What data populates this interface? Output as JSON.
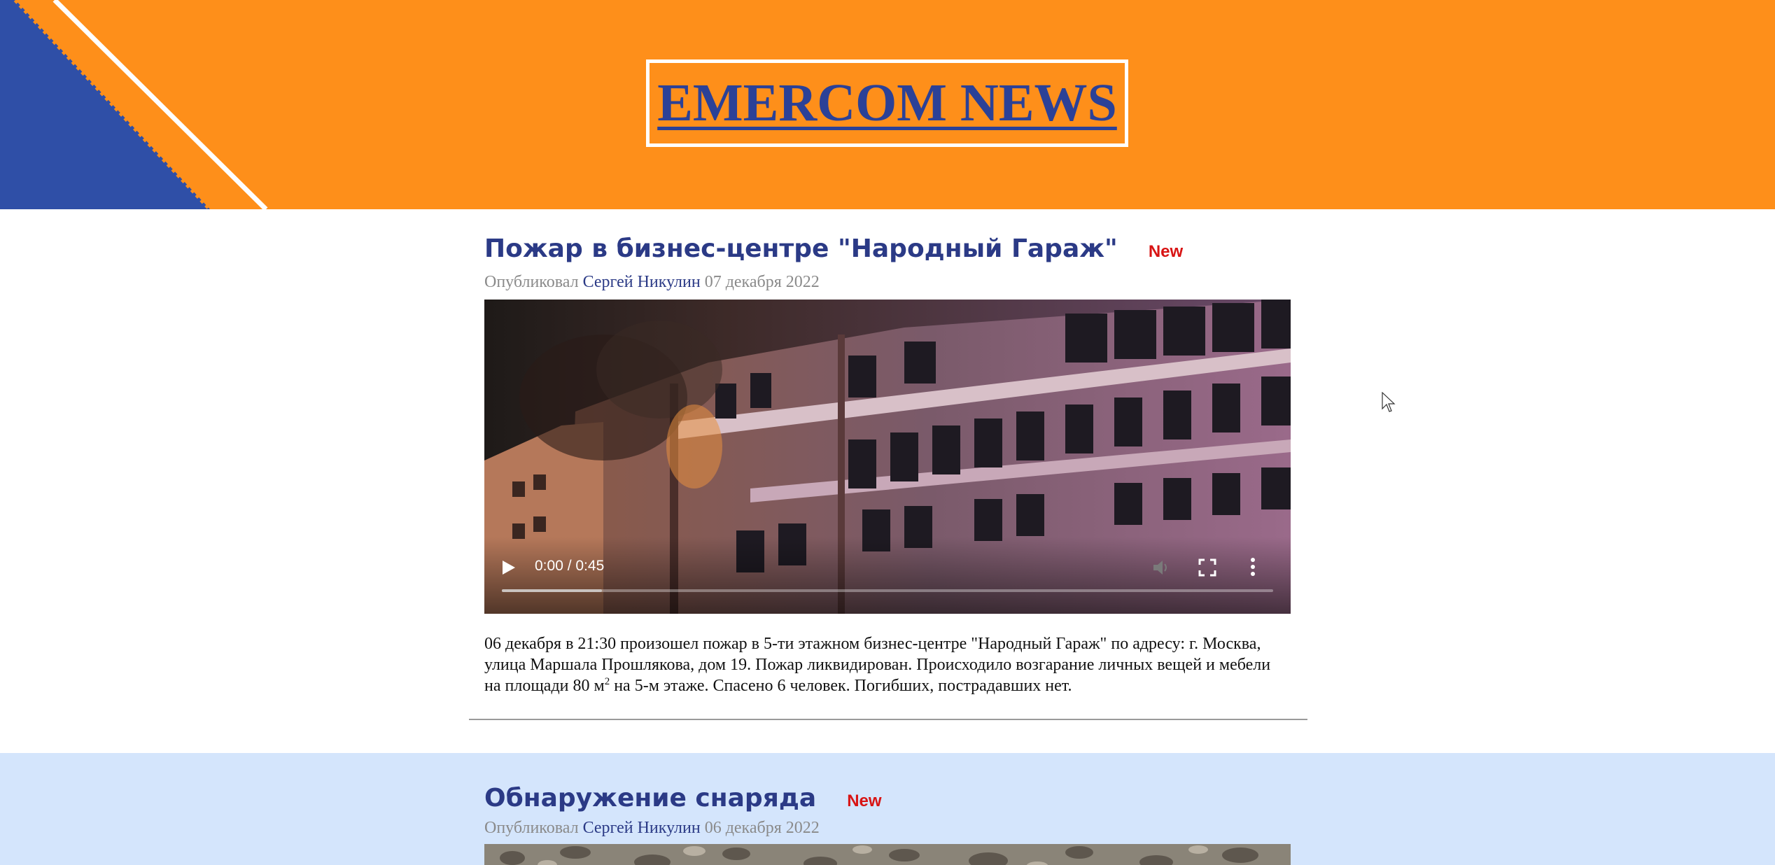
{
  "header": {
    "logo_text": "EMERCOM NEWS",
    "colors": {
      "background": "#fe8f1a",
      "accent_blue": "#2f4fa7",
      "logo_text": "#2b4197"
    }
  },
  "articles": [
    {
      "title": "Пожар в бизнес-центре \"Народный Гараж\"",
      "badge": "New",
      "meta_prefix": "Опубликовал",
      "author": "Сергей Никулин",
      "date": "07 декабря 2022",
      "video": {
        "time": "0:00 / 0:45",
        "buffered_fraction": 0.13,
        "controls": [
          "play-icon",
          "mute-icon",
          "fullscreen-icon",
          "more-options-icon"
        ]
      },
      "body_part1": "06 декабря в 21:30 произошел пожар в 5-ти этажном бизнес-центре \"Народный Гараж\" по адресу: г. Москва, улица Маршала Прошлякова, дом 19. Пожар ликвидирован. Происходило возгарание личных вещей и мебели на площади 80 м",
      "body_sup": "2",
      "body_part2": " на 5-м этаже. Спасено 6 человек. Погибших, пострадавших нет."
    },
    {
      "title": "Обнаружение снаряда",
      "badge": "New",
      "meta_prefix": "Опубликовал",
      "author": "Сергей Никулин",
      "date": "06 декабря 2022"
    }
  ],
  "colors": {
    "article_alt_bg": "#d4e5fc",
    "title": "#2b3a86",
    "badge": "#d81414",
    "meta": "#8a8a8a"
  }
}
